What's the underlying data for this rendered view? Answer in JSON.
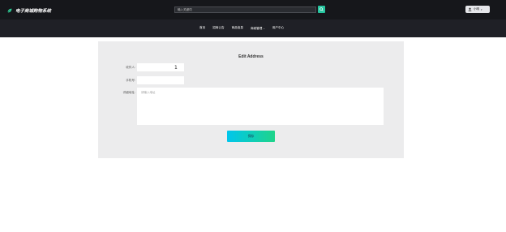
{
  "header": {
    "brand": "电子商城购物系统",
    "search_placeholder": "输入关键词",
    "user_name": "小明"
  },
  "nav": {
    "items": [
      {
        "label": "首页"
      },
      {
        "label": "招商公告"
      },
      {
        "label": "商品信息"
      },
      {
        "label": "商城管理"
      },
      {
        "label": "用户中心"
      }
    ]
  },
  "form": {
    "title": "Edit Address",
    "name_label": "收件人:",
    "name_value": "1",
    "phone_label": "手机号:",
    "address_label": "详细地址:",
    "address_placeholder": "请输入地址",
    "save_label": "保存"
  },
  "colors": {
    "header_bg": "#16171b",
    "nav_bg": "#1f2026",
    "panel_bg": "#ececed",
    "accent_start": "#00c6ec",
    "accent_end": "#1ed48a",
    "search_btn": "#26c6a0"
  }
}
